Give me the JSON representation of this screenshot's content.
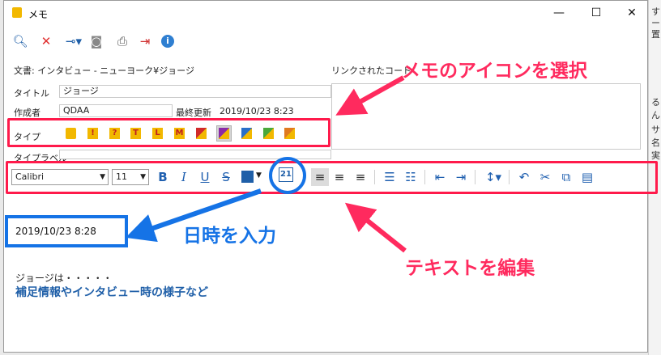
{
  "window": {
    "title": "メモ",
    "minimize": "—",
    "maximize": "☐",
    "close": "✕"
  },
  "background_right": {
    "lines": [
      "す",
      "ー",
      "置",
      "る",
      "ん",
      "サ",
      "名",
      "実"
    ]
  },
  "toolbar": {
    "icons": [
      "search-icon",
      "delete-icon",
      "key-icon",
      "users-icon",
      "print-icon",
      "export-icon",
      "info-icon"
    ]
  },
  "header": {
    "document_label": "文書: インタビュー - ニューヨーク¥ジョージ",
    "linked_label": "リンクされたコード"
  },
  "form": {
    "title_label": "タイトル",
    "title_value": "ジョージ",
    "author_label": "作成者",
    "author_value": "QDAA",
    "updated_label": "最終更新",
    "updated_value": "2019/10/23 8:23",
    "type_label": "タイプ",
    "type_icons": [
      "memo",
      "!",
      "?",
      "T",
      "L",
      "M",
      "diag-red",
      "diag-purple",
      "diag-blue",
      "diag-green",
      "diag-orange"
    ],
    "type_label_label": "タイプラベル"
  },
  "format": {
    "font": "Calibri",
    "size": "11",
    "bold": "B",
    "italic": "I",
    "underline": "U",
    "strike": "S",
    "date_icon": "21"
  },
  "editor": {
    "date_line": "2019/10/23 8:28",
    "line1": "ジョージは・・・・・",
    "line2": "補足情報やインタビュー時の様子など"
  },
  "annotations": {
    "select_icon": "メモのアイコンを選択",
    "insert_date": "日時を入力",
    "edit_text": "テキストを編集"
  },
  "colors": {
    "pink": "#ff1a4b",
    "blue": "#1573e6",
    "memo_yellow": "#f2b800"
  }
}
